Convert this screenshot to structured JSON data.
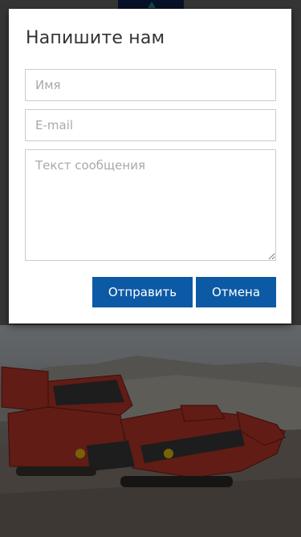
{
  "modal": {
    "title": "Напишите нам",
    "name_placeholder": "Имя",
    "email_placeholder": "E-mail",
    "message_placeholder": "Текст сообщения",
    "send_label": "Отправить",
    "cancel_label": "Отмена"
  },
  "colors": {
    "button": "#0c5aa6",
    "overlay": "rgba(0,0,0,0.5)",
    "logo": "#0f2250"
  }
}
